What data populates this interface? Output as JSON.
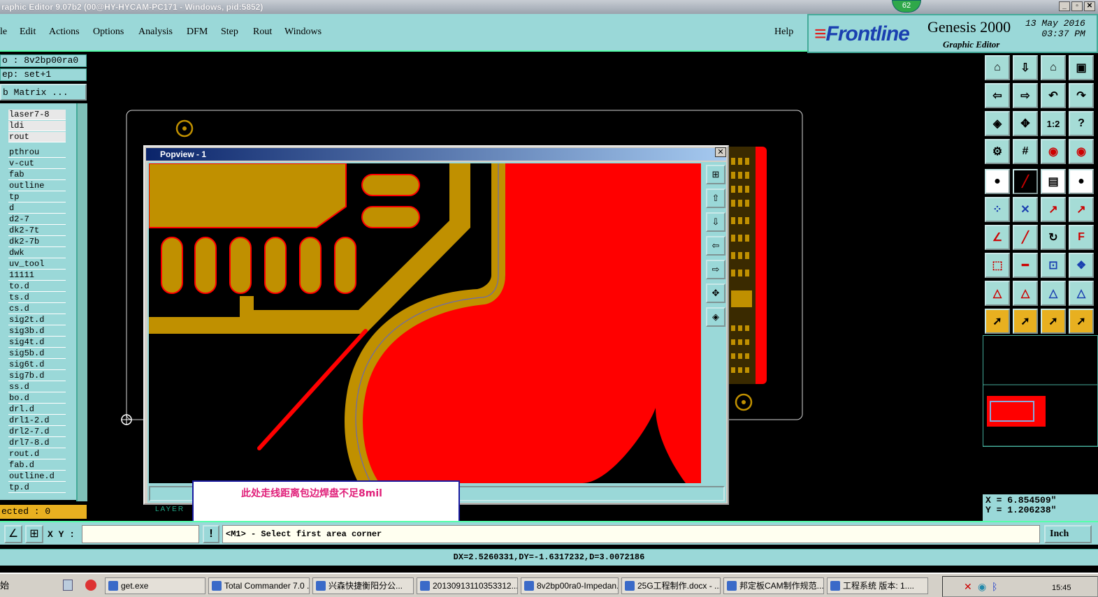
{
  "window": {
    "title": "raphic Editor 9.07b2 (00@HY-HYCAM-PC171 - Windows, pid:5852)",
    "badge": "62"
  },
  "menu": [
    "le",
    "Edit",
    "Actions",
    "Options",
    "Analysis",
    "DFM",
    "Step",
    "Rout",
    "Windows"
  ],
  "help_label": "Help",
  "brand": {
    "logo": "Frontline",
    "product": "Genesis 2000",
    "subtitle": "Graphic Editor",
    "date": "13 May 2016",
    "time": "03:37 PM"
  },
  "left": {
    "job": "o : 8v2bp00ra0",
    "step": "ep: set+1",
    "matrix_button": "b Matrix ...",
    "layers": [
      "laser7-8",
      "ldi",
      "rout",
      "pthrou",
      "v-cut",
      "fab",
      "outline",
      "tp",
      "d",
      "d2-7",
      "dk2-7t",
      "dk2-7b",
      "dwk",
      "uv_tool",
      "11111",
      "to.d",
      "ts.d",
      "cs.d",
      "sig2t.d",
      "sig3b.d",
      "sig4t.d",
      "sig5b.d",
      "sig6t.d",
      "sig7b.d",
      "ss.d",
      "bo.d",
      "drl.d",
      "drl1-2.d",
      "drl2-7.d",
      "drl7-8.d",
      "rout.d",
      "fab.d",
      "outline.d",
      "tp.d"
    ],
    "selected": "ected : 0"
  },
  "popview": {
    "title": "Popview - 1",
    "layer_label": "LAYER"
  },
  "note": "此处走线距离包边焊盘不足8mil",
  "xy_label": "X Y :",
  "prompt": "<M1> - Select first area corner",
  "units": "Inch",
  "coords": {
    "x": "X = 6.854509\"",
    "y": "Y = 1.206238\""
  },
  "measure": "DX=2.5260331,DY=-1.6317232,D=3.0072186",
  "taskbar": {
    "start": "始",
    "tasks": [
      "get.exe",
      "Total Commander 7.0 ...",
      "兴森快捷衡阳分公...",
      "20130913110353312....",
      "8v2bp00ra0-Impedan...",
      "25G工程制作.docx - ...",
      "邦定板CAM制作规范...",
      "工程系统 版本: 1...."
    ],
    "clock": "15:45"
  },
  "colors": {
    "panel": "#9ad8d8",
    "copper": "#c09000",
    "pad": "#ff0000"
  }
}
